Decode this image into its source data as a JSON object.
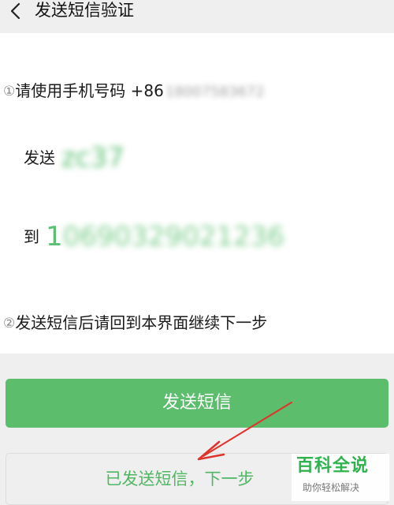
{
  "header": {
    "title": "发送短信验证"
  },
  "step1": {
    "number": "①",
    "text": "请使用手机号码 +86",
    "phone_hint": "18007583672"
  },
  "send_row": {
    "label": "发送",
    "code": "zc37"
  },
  "to_row": {
    "label": "到",
    "number_first": "1",
    "number_rest": "0690329021236"
  },
  "step2": {
    "number": "②",
    "text": "发送短信后请回到本界面继续下一步"
  },
  "buttons": {
    "send_sms": "发送短信",
    "next_step": "已发送短信，下一步"
  },
  "watermark": {
    "title": "百科全说",
    "subtitle": "助你轻松解决"
  },
  "colors": {
    "accent": "#5cbd6c",
    "annotation_arrow": "#e0322a"
  }
}
